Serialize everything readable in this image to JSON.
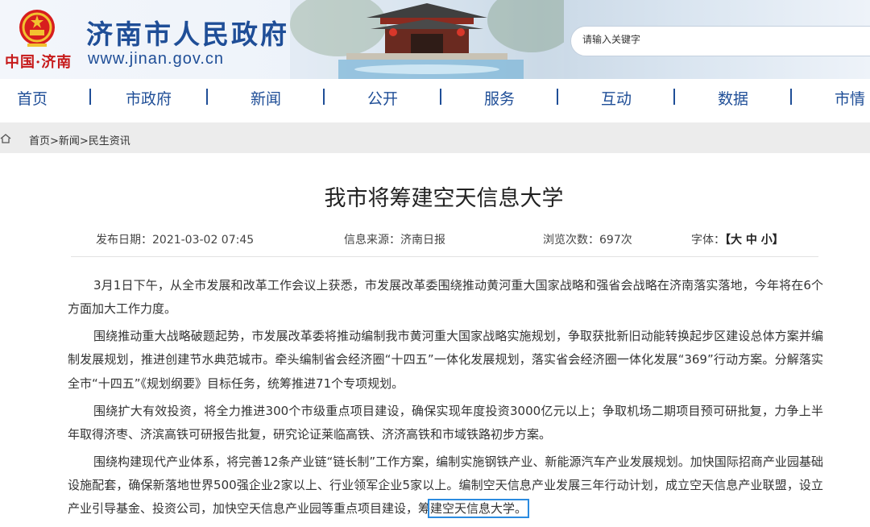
{
  "header": {
    "site_title": "济南市人民政府",
    "brand_text": "中国·济南",
    "site_url": "www.jinan.gov.cn",
    "search_placeholder": "请输入关键字"
  },
  "nav": {
    "items": [
      "首页",
      "市政府",
      "新闻",
      "公开",
      "服务",
      "互动",
      "数据",
      "市情"
    ],
    "separator": "|"
  },
  "breadcrumb": "首页>新闻>民生资讯",
  "article": {
    "title": "我市将筹建空天信息大学",
    "meta": {
      "date": "发布日期：2021-03-02 07:45",
      "source": "信息来源：济南日报",
      "views": "浏览次数：697次",
      "font_label": "字体：",
      "font_sizes": "【大 中 小】"
    },
    "paragraphs": [
      "3月1日下午，从全市发展和改革工作会议上获悉，市发展改革委围绕推动黄河重大国家战略和强省会战略在济南落实落地，今年将在6个方面加大工作力度。",
      "围绕推动重大战略破题起势，市发展改革委将推动编制我市黄河重大国家战略实施规划，争取获批新旧动能转换起步区建设总体方案并编制发展规划，推进创建节水典范城市。牵头编制省会经济圈“十四五”一体化发展规划，落实省会经济圈一体化发展“369”行动方案。分解落实全市“十四五”《规划纲要》目标任务，统筹推进71个专项规划。",
      "围绕扩大有效投资，将全力推进300个市级重点项目建设，确保实现年度投资3000亿元以上；争取机场二期项目预可研批复，力争上半年取得济枣、济滨高铁可研报告批复，研究论证莱临高铁、济济高铁和市域铁路初步方案。"
    ],
    "last_paragraph_lead": "围绕构建现代产业体系，将完善12条产业链“链长制”工作方案，编制实施钢铁产业、新能源汽车产业发展规划。加快国际招商产业园基础设施配套，确保新落地世界500强企业2家以上、行业领军企业5家以上。编制空天信息产业发展三年行动计划，成立空天信息产业联盟，设立产业引导基金、投资公司，加快空天信息产业园等重点项目建设，筹",
    "last_paragraph_highlight": "建空天信息大学。"
  },
  "colors": {
    "brand_blue": "#1f4e97",
    "brand_red": "#c61a1a",
    "highlight_box": "#2b8be0"
  },
  "icons": [
    "national-emblem-icon",
    "home-icon"
  ]
}
